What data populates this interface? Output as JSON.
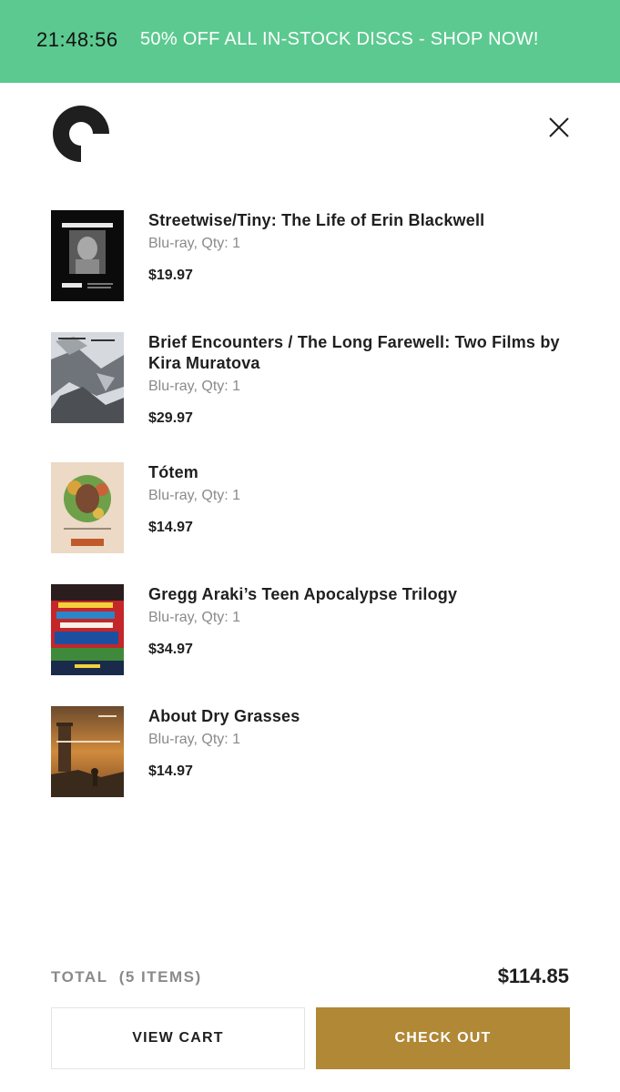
{
  "banner": {
    "time": "21:48:56",
    "text": "50% OFF ALL IN-STOCK DISCS - SHOP NOW!",
    "color": "#5cc990"
  },
  "header": {
    "logo_icon": "criterion-c-logo",
    "close_icon": "close-icon"
  },
  "cart": {
    "items": [
      {
        "title": "Streetwise/Tiny: The Life of Erin Blackwell",
        "meta": "Blu-ray, Qty: 1",
        "price": "$19.97"
      },
      {
        "title": "Brief Encounters / The Long Farewell: Two Films by Kira Muratova",
        "meta": "Blu-ray, Qty: 1",
        "price": "$29.97"
      },
      {
        "title": "Tótem",
        "meta": "Blu-ray, Qty: 1",
        "price": "$14.97"
      },
      {
        "title": "Gregg Araki’s Teen Apocalypse Trilogy",
        "meta": "Blu-ray, Qty: 1",
        "price": "$34.97"
      },
      {
        "title": "About Dry Grasses",
        "meta": "Blu-ray, Qty: 1",
        "price": "$14.97"
      }
    ]
  },
  "footer": {
    "total_label": "TOTAL  (5 ITEMS)",
    "total_value": "$114.85",
    "view_cart": "VIEW CART",
    "check_out": "CHECK OUT",
    "accent": "#b08836"
  }
}
